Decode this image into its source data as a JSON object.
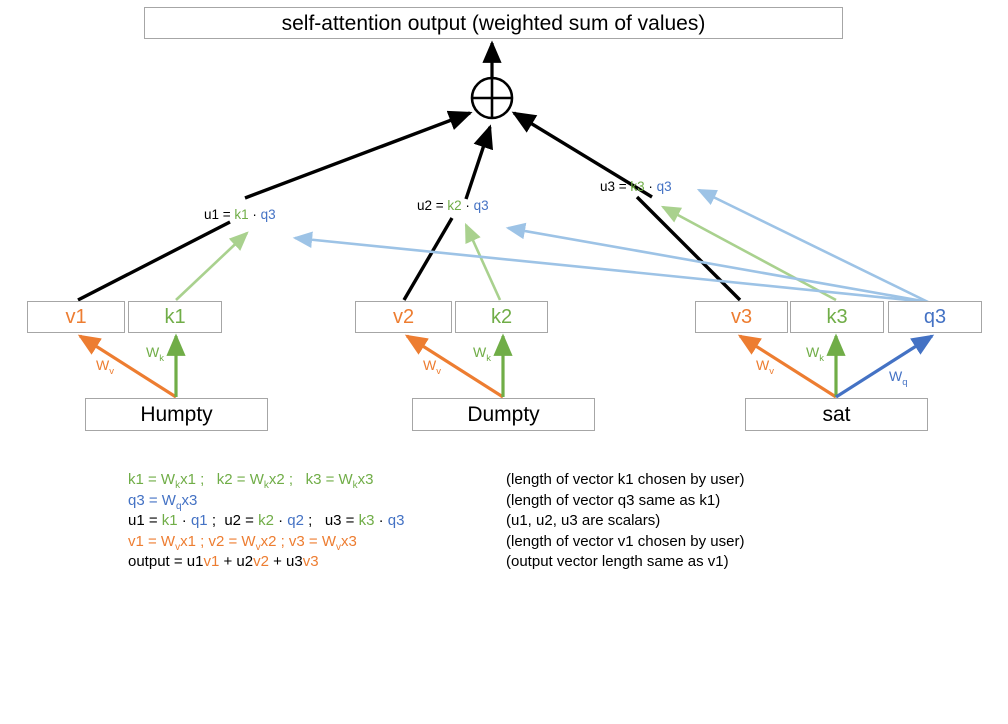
{
  "diagram": {
    "title": "self-attention output (weighted sum of values)",
    "sum_node": "⊕",
    "colors": {
      "value_orange": "#ED7D31",
      "key_green": "#70AD47",
      "query_blue": "#4472C4",
      "arrow_light_green": "#A9D18E",
      "arrow_light_blue": "#9DC3E6",
      "box_border": "#A6A6A6",
      "arrow_black": "#000000"
    },
    "tokens": [
      {
        "word": "Humpty",
        "value_label": "v1",
        "key_label": "k1",
        "query_label": null
      },
      {
        "word": "Dumpty",
        "value_label": "v2",
        "key_label": "k2",
        "query_label": null
      },
      {
        "word": "sat",
        "value_label": "v3",
        "key_label": "k3",
        "query_label": "q3"
      }
    ],
    "weight_labels": {
      "value": "W",
      "value_sub": "v",
      "key": "W",
      "key_sub": "k",
      "query": "W",
      "query_sub": "q"
    },
    "scores": [
      {
        "lhs": "u1 = ",
        "key": "k1",
        "dot": " · ",
        "query": "q3"
      },
      {
        "lhs": "u2 = ",
        "key": "k2",
        "dot": " · ",
        "query": "q3"
      },
      {
        "lhs": "u3 = ",
        "key": "k3",
        "dot": " · ",
        "query": "q3"
      }
    ]
  },
  "formulas": [
    {
      "parts": [
        {
          "t": "k1 = W",
          "c": "k"
        },
        {
          "t": "k",
          "c": "k",
          "sub": true
        },
        {
          "t": "x1 ;   k2 = W",
          "c": "k"
        },
        {
          "t": "k",
          "c": "k",
          "sub": true
        },
        {
          "t": "x2 ;   k3 = W",
          "c": "k"
        },
        {
          "t": "k",
          "c": "k",
          "sub": true
        },
        {
          "t": "x3",
          "c": "k"
        }
      ],
      "note": "(length of vector k1 chosen by user)"
    },
    {
      "parts": [
        {
          "t": "q3 = W",
          "c": "q"
        },
        {
          "t": "q",
          "c": "q",
          "sub": true
        },
        {
          "t": "x3",
          "c": "q"
        }
      ],
      "note": "(length of vector q3 same as k1)"
    },
    {
      "parts": [
        {
          "t": "u1 = ",
          "c": "n"
        },
        {
          "t": "k1",
          "c": "k"
        },
        {
          "t": " · ",
          "c": "n"
        },
        {
          "t": "q1",
          "c": "q"
        },
        {
          "t": " ;  u2 = ",
          "c": "n"
        },
        {
          "t": "k2",
          "c": "k"
        },
        {
          "t": " · ",
          "c": "n"
        },
        {
          "t": "q2",
          "c": "q"
        },
        {
          "t": " ;   u3 = ",
          "c": "n"
        },
        {
          "t": "k3",
          "c": "k"
        },
        {
          "t": " · ",
          "c": "n"
        },
        {
          "t": "q3",
          "c": "q"
        }
      ],
      "note": "(u1, u2, u3 are scalars)"
    },
    {
      "parts": [
        {
          "t": "v1 = W",
          "c": "v"
        },
        {
          "t": "v",
          "c": "v",
          "sub": true
        },
        {
          "t": "x1 ; v2 = W",
          "c": "v"
        },
        {
          "t": "v",
          "c": "v",
          "sub": true
        },
        {
          "t": "x2 ; v3 = W",
          "c": "v"
        },
        {
          "t": "v",
          "c": "v",
          "sub": true
        },
        {
          "t": "x3",
          "c": "v"
        }
      ],
      "note": "(length of vector v1 chosen by user)"
    },
    {
      "parts": [
        {
          "t": "output = u1",
          "c": "n"
        },
        {
          "t": "v1",
          "c": "v"
        },
        {
          "t": " + u2",
          "c": "n"
        },
        {
          "t": "v2",
          "c": "v"
        },
        {
          "t": " + u3",
          "c": "n"
        },
        {
          "t": "v3",
          "c": "v"
        }
      ],
      "note": "(output vector length same as v1)"
    }
  ]
}
